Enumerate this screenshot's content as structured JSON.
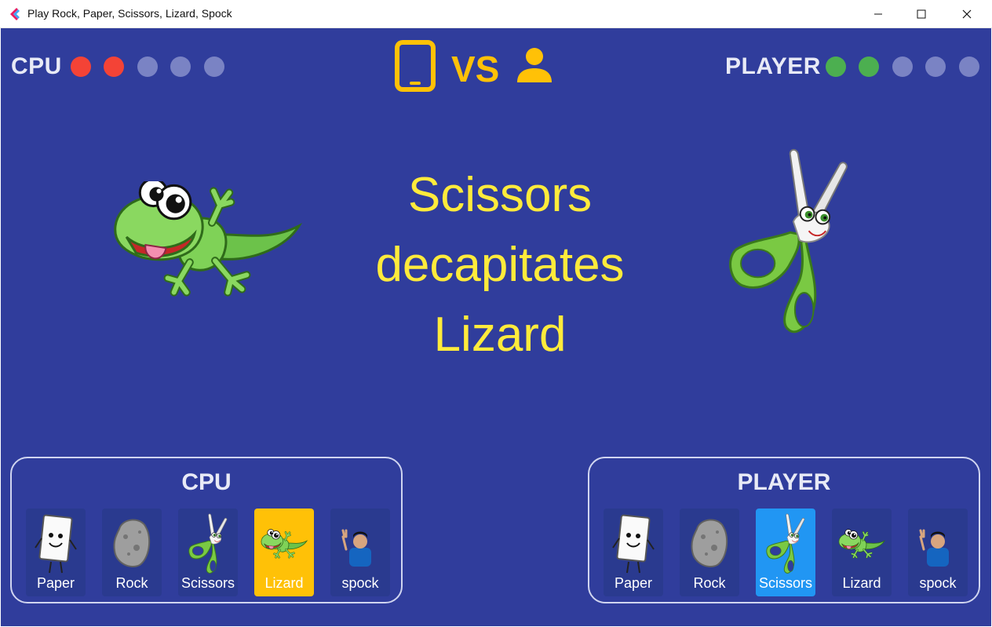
{
  "window": {
    "title": "Play Rock, Paper, Scissors, Lizard, Spock"
  },
  "colors": {
    "background": "#303d9c",
    "accent": "#ffc107",
    "result_text": "#ffeb3b",
    "cpu_win": "#f44336",
    "player_win": "#4caf50",
    "empty_dot": "#7a83c4",
    "player_selected": "#2196f3"
  },
  "scoreboard": {
    "cpu": {
      "label": "CPU",
      "wins": 2,
      "dots": [
        "#f44336",
        "#f44336",
        "#7a83c4",
        "#7a83c4",
        "#7a83c4"
      ]
    },
    "vs_label": "VS",
    "player": {
      "label": "PLAYER",
      "wins": 2,
      "dots": [
        "#4caf50",
        "#4caf50",
        "#7a83c4",
        "#7a83c4",
        "#7a83c4"
      ]
    }
  },
  "result": {
    "line1": "Scissors",
    "line2": "decapitates",
    "line3": "Lizard"
  },
  "cpu_panel": {
    "title": "CPU",
    "selected": "Lizard",
    "options": [
      {
        "label": "Paper",
        "icon": "paper-icon"
      },
      {
        "label": "Rock",
        "icon": "rock-icon"
      },
      {
        "label": "Scissors",
        "icon": "scissors-icon"
      },
      {
        "label": "Lizard",
        "icon": "lizard-icon"
      },
      {
        "label": "spock",
        "icon": "spock-icon"
      }
    ]
  },
  "player_panel": {
    "title": "PLAYER",
    "selected": "Scissors",
    "options": [
      {
        "label": "Paper",
        "icon": "paper-icon"
      },
      {
        "label": "Rock",
        "icon": "rock-icon"
      },
      {
        "label": "Scissors",
        "icon": "scissors-icon"
      },
      {
        "label": "Lizard",
        "icon": "lizard-icon"
      },
      {
        "label": "spock",
        "icon": "spock-icon"
      }
    ]
  }
}
